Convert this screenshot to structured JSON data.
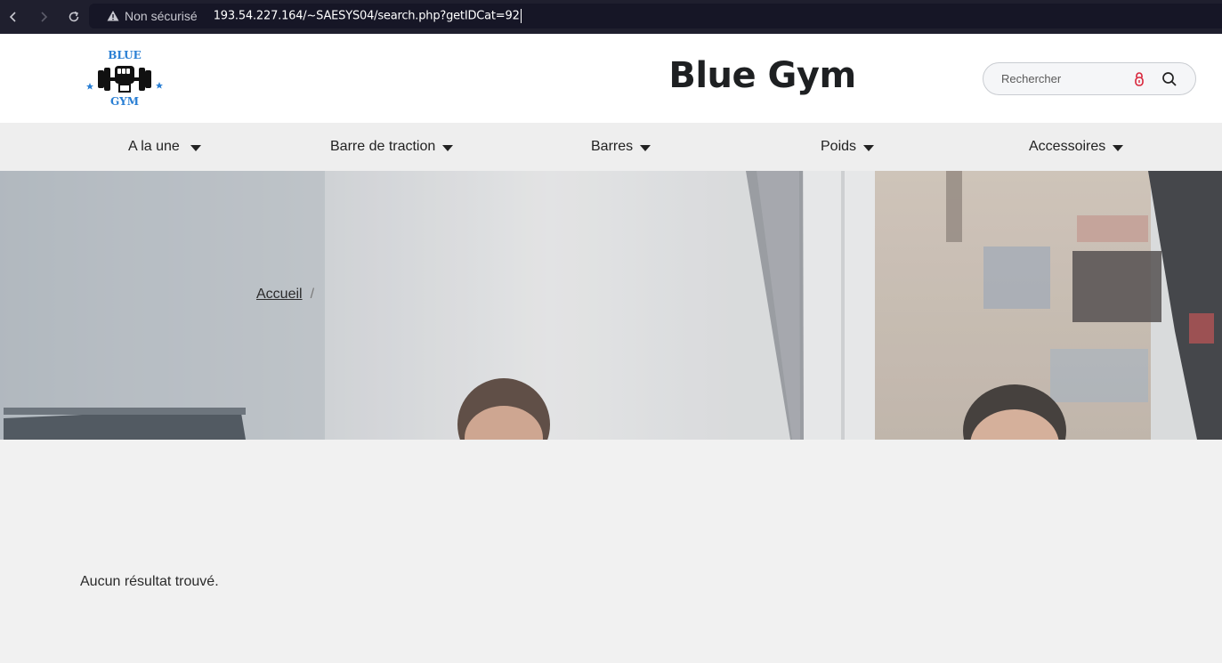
{
  "browser": {
    "security_label": "Non sécurisé",
    "url": "193.54.227.164/~SAESYS04/search.php?getIDCat=92"
  },
  "header": {
    "logo_text_top": "BLUE",
    "logo_text_bottom": "GYM",
    "site_title": "Blue Gym",
    "search_placeholder": "Rechercher"
  },
  "menu": {
    "items": [
      {
        "label": "A la une"
      },
      {
        "label": "Barre de traction"
      },
      {
        "label": "Barres"
      },
      {
        "label": "Poids"
      },
      {
        "label": "Accessoires"
      }
    ]
  },
  "hero": {
    "breadcrumb_home": "Accueil",
    "breadcrumb_sep": "/"
  },
  "content": {
    "no_results": "Aucun résultat trouvé."
  },
  "colors": {
    "brand_blue": "#2a7fd4",
    "chrome_bg": "#1f1f2e",
    "lock_red": "#d8243a"
  }
}
